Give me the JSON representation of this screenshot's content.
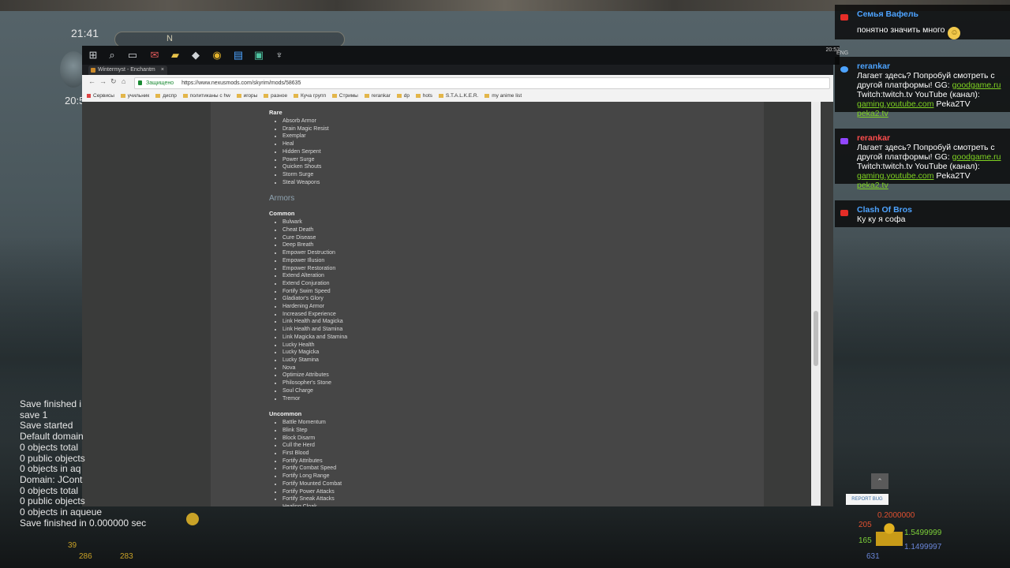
{
  "game": {
    "clock": "21:41",
    "clock_secondary": "20:5",
    "compass_mark": "N"
  },
  "taskbar": {
    "time": "20:53",
    "lang": "ENG"
  },
  "browser": {
    "tab_title": "Wintermyst - Enchantm",
    "secure_label": "Защищено",
    "url": "https://www.nexusmods.com/skyrim/mods/58635",
    "bookmarks": [
      "Сервисы",
      "учильник",
      "диспр",
      "политиканы с hw",
      "игоры",
      "разное",
      "Куча групп",
      "Стримы",
      "rerankar",
      "dp",
      "hots",
      "S.T.A.L.K.E.R.",
      "my anime list"
    ]
  },
  "page": {
    "rare_title": "Rare",
    "rare_items": [
      "Absorb Armor",
      "Drain Magic Resist",
      "Exemplar",
      "Heal",
      "Hidden Serpent",
      "Power Surge",
      "Quicken Shouts",
      "Storm Surge",
      "Steal Weapons"
    ],
    "armors_heading": "Armors",
    "common_title": "Common",
    "common_items": [
      "Bulwark",
      "Cheat Death",
      "Cure Disease",
      "Deep Breath",
      "Empower Destruction",
      "Empower Illusion",
      "Empower Restoration",
      "Extend Alteration",
      "Extend Conjuration",
      "Fortify Swim Speed",
      "Gladiator's Glory",
      "Hardening Armor",
      "Increased Experience",
      "Link Health and Magicka",
      "Link Health and Stamina",
      "Link Magicka and Stamina",
      "Lucky Health",
      "Lucky Magicka",
      "Lucky Stamina",
      "Nova",
      "Optimize Attributes",
      "Philosopher's Stone",
      "Soul Charge",
      "Tremor"
    ],
    "uncommon_title": "Uncommon",
    "uncommon_items": [
      "Battle Momentum",
      "Blink Step",
      "Block Disarm",
      "Cull the Herd",
      "First Blood",
      "Fortify Attributes",
      "Fortify Combat Speed",
      "Fortify Long Range",
      "Fortify Mounted Combat",
      "Fortify Power Attacks",
      "Fortify Sneak Attacks",
      "Healing Cloak"
    ],
    "report_label": "REPORT BUG"
  },
  "chat": [
    {
      "user": "Семья Вафель",
      "text": "понятно значить много",
      "source": "youtube",
      "user_color": "#4da3ff"
    },
    {
      "user": "rerankar",
      "source": "goodgame",
      "user_color": "#4da3ff",
      "t1": "Лагает здесь? Попробуй смотреть с другой платформы! GG: ",
      "l1": "goodgame.ru",
      "t2": "Twitch:twitch.tv YouTube (канал): ",
      "l2": "gaming.youtube.com",
      "t3": " Peka2TV ",
      "l3": "peka2.tv"
    },
    {
      "user": "rerankar",
      "source": "twitch",
      "user_color": "#ff4d4d",
      "t1": "Лагает здесь? Попробуй смотреть с другой платформы! GG: ",
      "l1": "goodgame.ru",
      "t2": "Twitch:twitch.tv YouTube (канал): ",
      "l2": "gaming.youtube.com",
      "t3": " Peka2TV ",
      "l3": "peka2.tv"
    },
    {
      "user": "Clash Of Bros",
      "text": "Ку ку я софа",
      "source": "youtube",
      "user_color": "#4da3ff"
    }
  ],
  "console": [
    "Save finished i",
    "save 1",
    "Save started",
    "Default domain",
    "0 objects total",
    "0 public objects",
    "0 objects in aq",
    "Domain: JCont",
    "0 objects total",
    "0 public objects",
    "0 objects in aqueue",
    "Save finished in 0.000000 sec"
  ],
  "hud": {
    "gold_a": "39",
    "gold_b": "286",
    "gold_c": "283",
    "v205": "205",
    "v165": "165",
    "v631": "631",
    "r1": "0.2000000",
    "r2": "1.5499999",
    "r3": "1.1499997"
  }
}
